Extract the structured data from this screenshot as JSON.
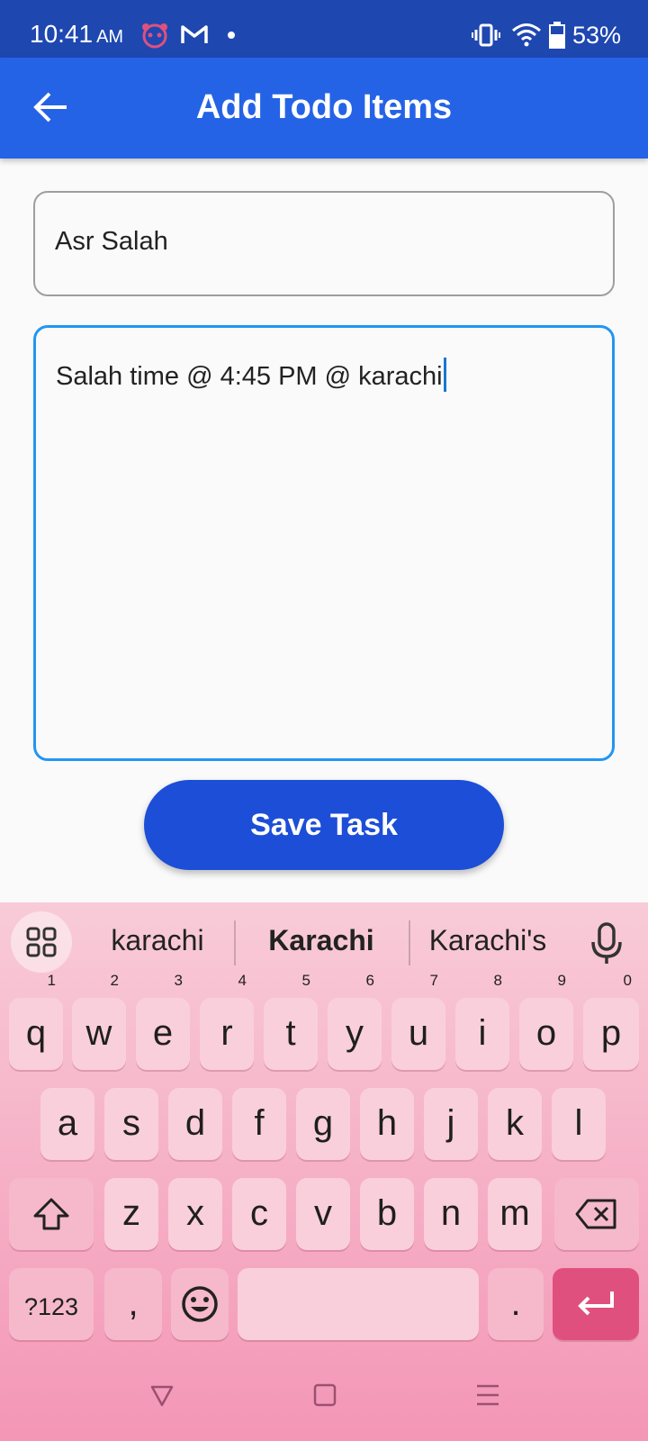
{
  "status_bar": {
    "time": "10:41",
    "ampm": "AM",
    "battery": "53%",
    "icons": [
      "panda-icon",
      "gmail-icon",
      "dot-icon",
      "vibrate-icon",
      "wifi-icon",
      "battery-icon"
    ]
  },
  "app_bar": {
    "title": "Add Todo Items",
    "back_icon": "arrow-left-icon",
    "color": "#2563e6"
  },
  "form": {
    "title_value": "Asr Salah",
    "description_value": "Salah time @ 4:45 PM @ karachi",
    "save_label": "Save Task",
    "accent": "#2196f3",
    "button_color": "#1d4ed8"
  },
  "keyboard": {
    "suggestions": [
      "karachi",
      "Karachi",
      "Karachi's"
    ],
    "row1": [
      {
        "key": "q",
        "hint": "1"
      },
      {
        "key": "w",
        "hint": "2"
      },
      {
        "key": "e",
        "hint": "3"
      },
      {
        "key": "r",
        "hint": "4"
      },
      {
        "key": "t",
        "hint": "5"
      },
      {
        "key": "y",
        "hint": "6"
      },
      {
        "key": "u",
        "hint": "7"
      },
      {
        "key": "i",
        "hint": "8"
      },
      {
        "key": "o",
        "hint": "9"
      },
      {
        "key": "p",
        "hint": "0"
      }
    ],
    "row2": [
      "a",
      "s",
      "d",
      "f",
      "g",
      "h",
      "j",
      "k",
      "l"
    ],
    "row3": [
      "z",
      "x",
      "c",
      "v",
      "b",
      "n",
      "m"
    ],
    "symbols_label": "?123",
    "comma": ",",
    "period": ".",
    "enter_color": "#e0507f"
  }
}
